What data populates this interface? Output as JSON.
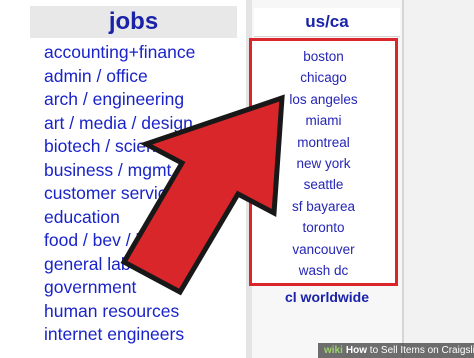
{
  "jobs": {
    "header": "jobs",
    "items": [
      "accounting+finance",
      "admin / office",
      "arch / engineering",
      "art / media / design",
      "biotech / science",
      "business / mgmt",
      "customer service",
      "education",
      "food / bev / hosp",
      "general labor",
      "government",
      "human resources",
      "internet engineers"
    ]
  },
  "region": {
    "header": "us/ca",
    "cities": [
      "boston",
      "chicago",
      "los angeles",
      "miami",
      "montreal",
      "new york",
      "seattle",
      "sf bayarea",
      "toronto",
      "vancouver",
      "wash dc"
    ],
    "worldwide": "cl worldwide"
  },
  "overlay": {
    "arrow_icon": "red-arrow-icon",
    "highlight_color": "#d8262b"
  },
  "watermark": {
    "brand": "wiki",
    "brand_suffix": "How",
    "text": "to Sell Items on Craigslist"
  },
  "colors": {
    "link": "#1a23c8",
    "accent_red": "#d8262b"
  }
}
